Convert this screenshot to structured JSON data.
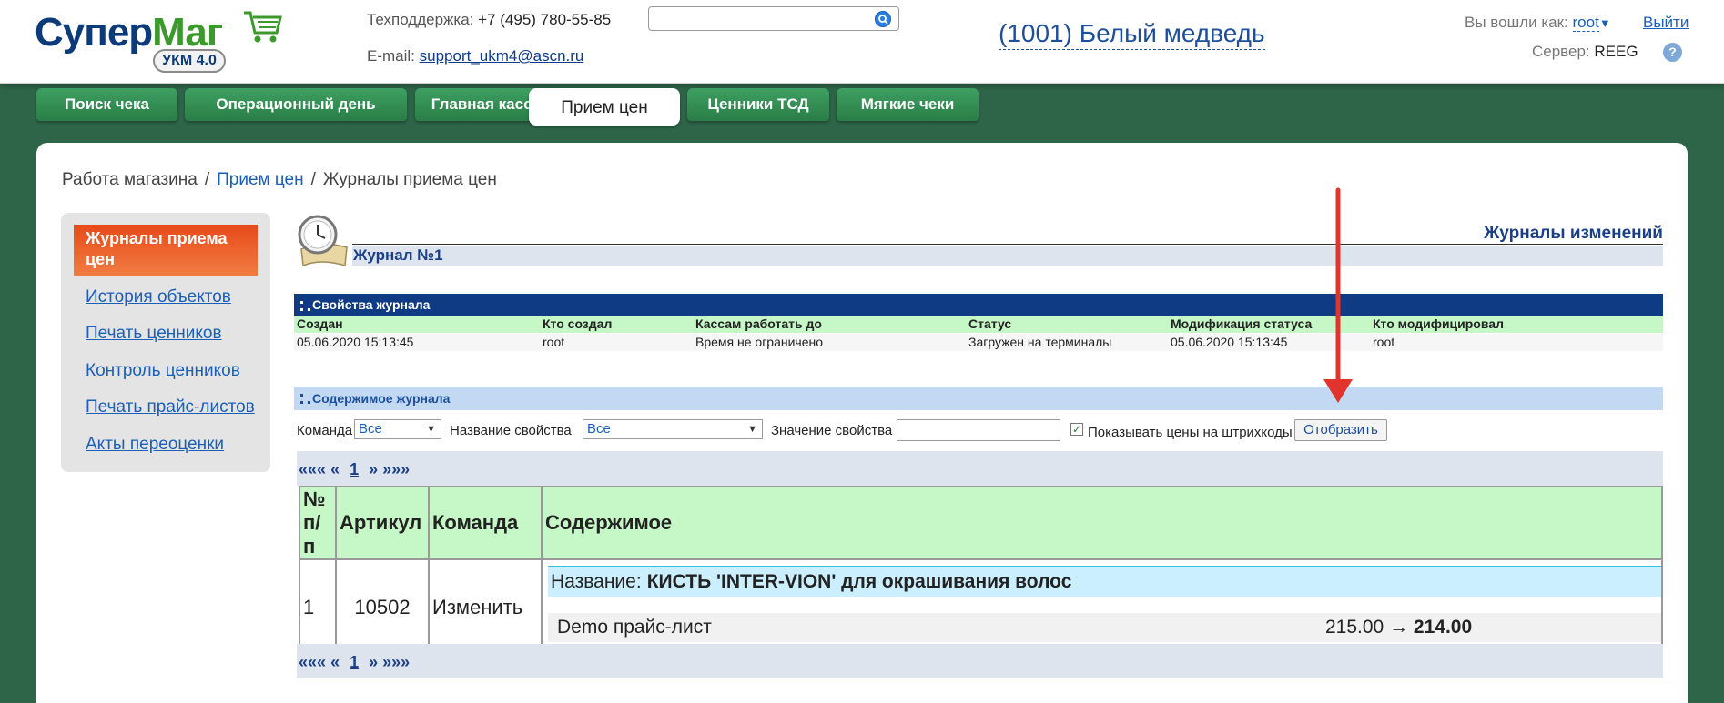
{
  "header": {
    "logo_main": "Супер",
    "logo_accent": "Маг",
    "logo_badge": "УКМ 4.0",
    "support_label": "Техподдержка:",
    "support_phone": "+7 (495) 780-55-85",
    "email_label": "E-mail:",
    "email_value": "support_ukm4@ascn.ru",
    "search_value": "",
    "store_name": "(1001) Белый медведь",
    "login_label": "Вы вошли как:",
    "login_user": "root",
    "logout_label": "Выйти",
    "server_label": "Сервер:",
    "server_value": "REEG",
    "help_label": "?"
  },
  "tabs": [
    {
      "label": "Поиск чека",
      "active": false
    },
    {
      "label": "Операционный день",
      "active": false
    },
    {
      "label": "Главная касса",
      "active": false
    },
    {
      "label": "Прием цен",
      "active": true
    },
    {
      "label": "Ценники ТСД",
      "active": false
    },
    {
      "label": "Мягкие чеки",
      "active": false
    }
  ],
  "breadcrumb": {
    "root": "Работа магазина",
    "link": "Прием цен",
    "current": "Журналы приема цен",
    "sep": "/"
  },
  "sidebar": {
    "active": "Журналы приема цен",
    "items": [
      "История объектов",
      "Печать ценников",
      "Контроль ценников",
      "Печать прайс-листов",
      "Акты переоценки"
    ]
  },
  "journal": {
    "changes_title": "Журналы изменений",
    "name": "Журнал №1"
  },
  "properties": {
    "title": "Свойства журнала",
    "headers": [
      "Создан",
      "Кто создал",
      "Кассам работать до",
      "Статус",
      "Модификация статуса",
      "Кто модифицировал"
    ],
    "values": [
      "05.06.2020 15:13:45",
      "root",
      "Время не ограничено",
      "Загружен на терминалы",
      "05.06.2020 15:13:45",
      "root"
    ]
  },
  "contents": {
    "title": "Содержимое журнала",
    "command_label": "Команда",
    "command_value": "Все",
    "prop_name_label": "Название свойства",
    "prop_name_value": "Все",
    "prop_value_label": "Значение свойства",
    "prop_value_input": "",
    "checkbox_checked": true,
    "checkbox_label": "Показывать цены на штрихкоды",
    "show_button": "Отобразить"
  },
  "pager": {
    "first": "«««",
    "prev": "«",
    "current": "1",
    "next": "»",
    "last": "»»»"
  },
  "table": {
    "headers": [
      "№ п/п",
      "Артикул",
      "Команда",
      "Содержимое"
    ],
    "rows": [
      {
        "num": "1",
        "article": "10502",
        "command": "Изменить",
        "name_label": "Название:",
        "name_value": "КИСТЬ 'INTER-VION' для окрашивания волос",
        "price_list": "Demo прайс-лист",
        "old_price": "215.00",
        "arrow": "→",
        "new_price": "214.00"
      }
    ]
  },
  "colors": {
    "background": "#2e6548",
    "tab": "#2a7e47",
    "accent": "#e84a1a",
    "header_bar": "#0e3b84",
    "annotation_arrow": "#e0342c"
  }
}
